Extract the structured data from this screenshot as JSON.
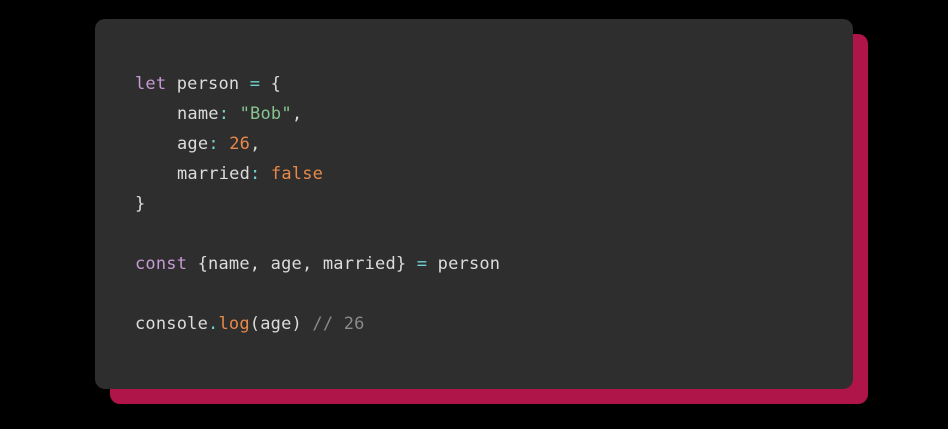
{
  "colors": {
    "page_background": "#000000",
    "card_background": "#2e2e2e",
    "card_shadow": "#b0154a",
    "keyword": "#c59ad6",
    "plain": "#dcdcdc",
    "operator": "#6fd3d0",
    "string": "#87c38f",
    "number": "#e8894a",
    "comment": "#8a8a8a"
  },
  "code": {
    "lines": [
      {
        "indent": 0,
        "tokens": [
          {
            "text": "let",
            "kind": "keyword"
          },
          {
            "text": " person ",
            "kind": "plain"
          },
          {
            "text": "=",
            "kind": "operator"
          },
          {
            "text": " {",
            "kind": "plain"
          }
        ]
      },
      {
        "indent": 1,
        "tokens": [
          {
            "text": "name",
            "kind": "plain"
          },
          {
            "text": ": ",
            "kind": "operator"
          },
          {
            "text": "\"Bob\"",
            "kind": "string"
          },
          {
            "text": ",",
            "kind": "plain"
          }
        ]
      },
      {
        "indent": 1,
        "tokens": [
          {
            "text": "age",
            "kind": "plain"
          },
          {
            "text": ": ",
            "kind": "operator"
          },
          {
            "text": "26",
            "kind": "number"
          },
          {
            "text": ",",
            "kind": "plain"
          }
        ]
      },
      {
        "indent": 1,
        "tokens": [
          {
            "text": "married",
            "kind": "plain"
          },
          {
            "text": ": ",
            "kind": "operator"
          },
          {
            "text": "false",
            "kind": "number"
          }
        ]
      },
      {
        "indent": 0,
        "tokens": [
          {
            "text": "}",
            "kind": "plain"
          }
        ]
      },
      {
        "indent": 0,
        "tokens": []
      },
      {
        "indent": 0,
        "tokens": [
          {
            "text": "const",
            "kind": "keyword"
          },
          {
            "text": " {name, age, married} ",
            "kind": "plain"
          },
          {
            "text": "=",
            "kind": "operator"
          },
          {
            "text": " person",
            "kind": "plain"
          }
        ]
      },
      {
        "indent": 0,
        "tokens": []
      },
      {
        "indent": 0,
        "tokens": [
          {
            "text": "console",
            "kind": "plain"
          },
          {
            "text": ".",
            "kind": "operator"
          },
          {
            "text": "log",
            "kind": "number"
          },
          {
            "text": "(age) ",
            "kind": "plain"
          },
          {
            "text": "// 26",
            "kind": "comment"
          }
        ]
      }
    ]
  }
}
